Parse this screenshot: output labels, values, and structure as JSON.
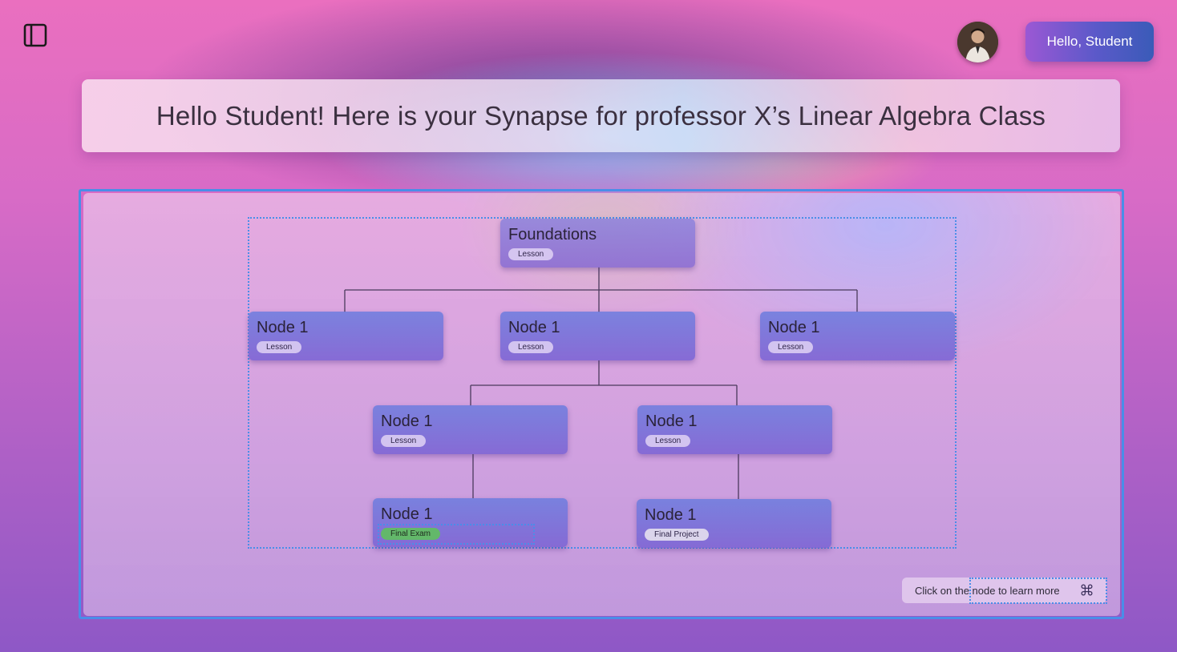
{
  "header": {
    "sidebar_toggle_icon": "sidebar-panel-icon",
    "avatar_icon": "user-avatar",
    "greeting_button_label": "Hello, Student"
  },
  "banner": {
    "title": "Hello Student! Here is your Synapse for professor X’s Linear Algebra Class"
  },
  "graph": {
    "root": {
      "title": "Foundations",
      "tag": "Lesson"
    },
    "level1": [
      {
        "title": "Node 1",
        "tag": "Lesson"
      },
      {
        "title": "Node 1",
        "tag": "Lesson"
      },
      {
        "title": "Node 1",
        "tag": "Lesson"
      }
    ],
    "level2": [
      {
        "title": "Node 1",
        "tag": "Lesson"
      },
      {
        "title": "Node 1",
        "tag": "Lesson"
      }
    ],
    "level3": [
      {
        "title": "Node 1",
        "tag": "Final Exam"
      },
      {
        "title": "Node 1",
        "tag": "Final Project"
      }
    ]
  },
  "hint": {
    "text": "Click on the node to learn more",
    "icon": "command-key-icon"
  },
  "colors": {
    "accent_border": "#4a8ee8",
    "final_exam_tag": "#63b86a",
    "greeting_button_start": "#9b58d4",
    "greeting_button_end": "#3a5bb8"
  }
}
